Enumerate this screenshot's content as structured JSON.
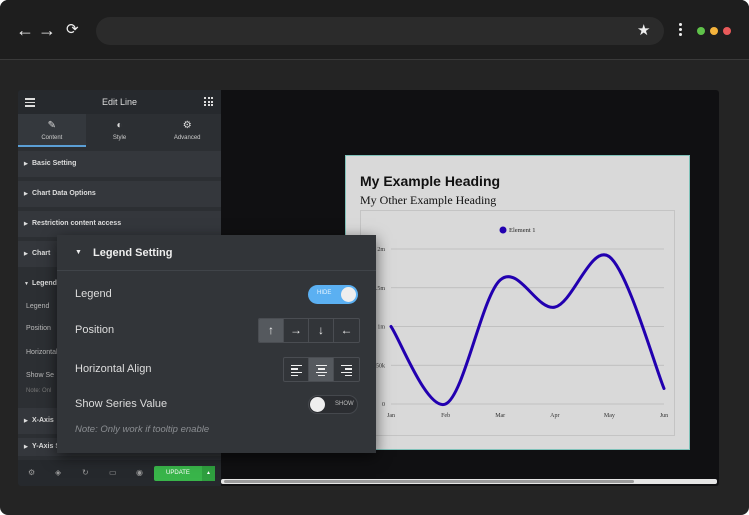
{
  "browser": {
    "back_icon": "←",
    "forward_icon": "→",
    "reload_icon": "⟳",
    "star_icon": "★",
    "traffic_colors": [
      "#5fc24a",
      "#f4b33c",
      "#e95a5a"
    ]
  },
  "panel": {
    "title": "Edit Line",
    "tabs": [
      {
        "label": "Content",
        "icon": "✎"
      },
      {
        "label": "Style",
        "icon": "◐"
      },
      {
        "label": "Advanced",
        "icon": "⚙"
      }
    ],
    "sections": [
      "Basic Setting",
      "Chart Data Options",
      "Restriction content access",
      "Chart"
    ],
    "bg_rows": [
      "Legend",
      "Legend",
      "Position",
      "Horizontal",
      "Show Se",
      "Note: Onl"
    ],
    "lower_sections": [
      "X-Axis",
      "Y-Axis Setting"
    ],
    "update_label": "UPDATE",
    "update_arrow": "▲"
  },
  "preview": {
    "heading": "My Example Heading",
    "subheading": "My Other Example Heading"
  },
  "chart_data": {
    "type": "line",
    "categories": [
      "Jan",
      "Feb",
      "Mar",
      "Apr",
      "May",
      "Jun"
    ],
    "series": [
      {
        "name": "Element 1",
        "values": [
          1.0,
          0.0,
          1.6,
          1.25,
          1.9,
          0.2
        ],
        "color": "#2200b0"
      }
    ],
    "ytick_labels": [
      "0",
      "50k",
      "1m",
      "1.5m",
      "2m"
    ],
    "yticks": [
      0,
      0.5,
      1,
      1.5,
      2
    ],
    "ylim": [
      0,
      2
    ],
    "legend_position": "top",
    "grid": true
  },
  "popup": {
    "title": "Legend Setting",
    "legend_label": "Legend",
    "legend_toggle": "HIDE",
    "position_label": "Position",
    "position_options": [
      "↑",
      "→",
      "↓",
      "←"
    ],
    "halign_label": "Horizontal Align",
    "series_label": "Show Series Value",
    "series_toggle": "SHOW",
    "note": "Note: Only work if tooltip enable"
  }
}
